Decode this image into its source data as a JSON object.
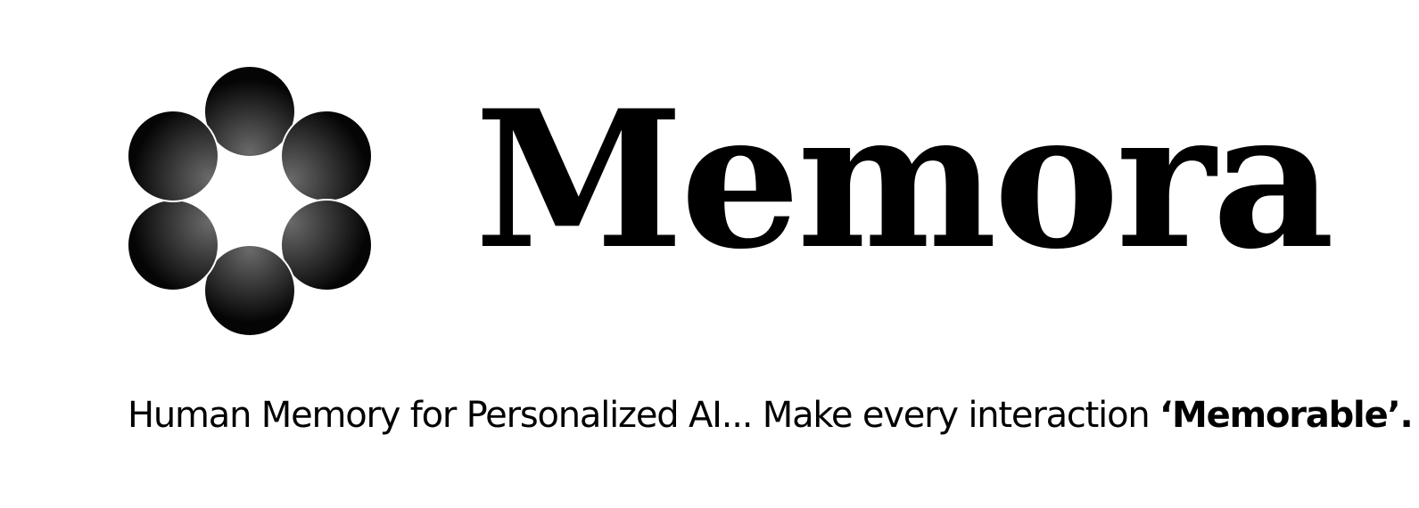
{
  "brand": {
    "name": "Memora",
    "color": "#000000"
  },
  "logo": {
    "icon": "six-sphere-ring-icon"
  },
  "tagline": {
    "text": "Human Memory for Personalized AI... Make every interaction ",
    "emphasis": "‘Memorable’."
  }
}
